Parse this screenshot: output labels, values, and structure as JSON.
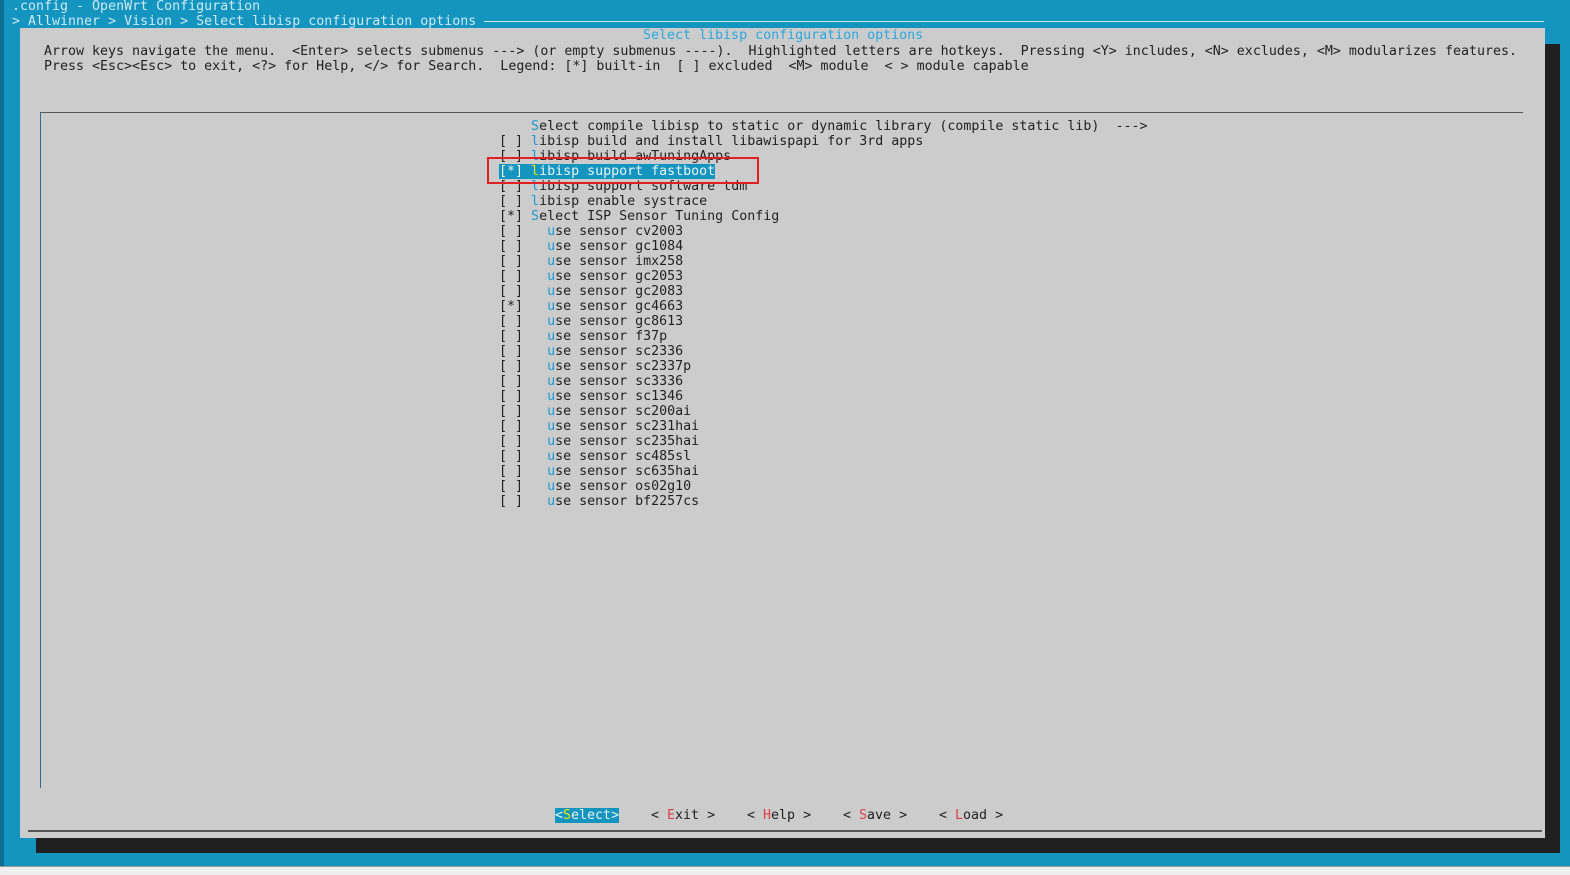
{
  "window": {
    "title": ".config - OpenWrt Configuration",
    "breadcrumb": "> Allwinner > Vision > Select libisp configuration options"
  },
  "dialog": {
    "title": "Select libisp configuration options",
    "help_line1": "Arrow keys navigate the menu.  <Enter> selects submenus ---> (or empty submenus ----).  Highlighted letters are hotkeys.  Pressing <Y> includes, <N> excludes, <M> modularizes features.",
    "help_line2": "Press <Esc><Esc> to exit, <?> for Help, </> for Search.  Legend: [*] built-in  [ ] excluded  <M> module  < > module capable"
  },
  "menu": [
    {
      "box": "   ",
      "indent": "",
      "hk": "S",
      "rest": "elect compile libisp to static or dynamic library (compile static lib)  --->"
    },
    {
      "box": "[ ]",
      "indent": "",
      "hk": "l",
      "rest": "ibisp build and install libawispapi for 3rd apps"
    },
    {
      "box": "[ ]",
      "indent": "",
      "hk": "l",
      "rest": "ibisp build awTuningApps"
    },
    {
      "box": "[*]",
      "indent": "",
      "hk": "l",
      "rest": "ibisp support fastboot",
      "selected": true
    },
    {
      "box": "[ ]",
      "indent": "",
      "hk": "l",
      "rest": "ibisp support software tdm"
    },
    {
      "box": "[ ]",
      "indent": "",
      "hk": "l",
      "rest": "ibisp enable systrace"
    },
    {
      "box": "[*]",
      "indent": "",
      "hk": "S",
      "rest": "elect ISP Sensor Tuning Config"
    },
    {
      "box": "[ ]",
      "indent": "  ",
      "hk": "u",
      "rest": "se sensor cv2003"
    },
    {
      "box": "[ ]",
      "indent": "  ",
      "hk": "u",
      "rest": "se sensor gc1084"
    },
    {
      "box": "[ ]",
      "indent": "  ",
      "hk": "u",
      "rest": "se sensor imx258"
    },
    {
      "box": "[ ]",
      "indent": "  ",
      "hk": "u",
      "rest": "se sensor gc2053"
    },
    {
      "box": "[ ]",
      "indent": "  ",
      "hk": "u",
      "rest": "se sensor gc2083"
    },
    {
      "box": "[*]",
      "indent": "  ",
      "hk": "u",
      "rest": "se sensor gc4663"
    },
    {
      "box": "[ ]",
      "indent": "  ",
      "hk": "u",
      "rest": "se sensor gc8613"
    },
    {
      "box": "[ ]",
      "indent": "  ",
      "hk": "u",
      "rest": "se sensor f37p"
    },
    {
      "box": "[ ]",
      "indent": "  ",
      "hk": "u",
      "rest": "se sensor sc2336"
    },
    {
      "box": "[ ]",
      "indent": "  ",
      "hk": "u",
      "rest": "se sensor sc2337p"
    },
    {
      "box": "[ ]",
      "indent": "  ",
      "hk": "u",
      "rest": "se sensor sc3336"
    },
    {
      "box": "[ ]",
      "indent": "  ",
      "hk": "u",
      "rest": "se sensor sc1346"
    },
    {
      "box": "[ ]",
      "indent": "  ",
      "hk": "u",
      "rest": "se sensor sc200ai"
    },
    {
      "box": "[ ]",
      "indent": "  ",
      "hk": "u",
      "rest": "se sensor sc231hai"
    },
    {
      "box": "[ ]",
      "indent": "  ",
      "hk": "u",
      "rest": "se sensor sc235hai"
    },
    {
      "box": "[ ]",
      "indent": "  ",
      "hk": "u",
      "rest": "se sensor sc485sl"
    },
    {
      "box": "[ ]",
      "indent": "  ",
      "hk": "u",
      "rest": "se sensor sc635hai"
    },
    {
      "box": "[ ]",
      "indent": "  ",
      "hk": "u",
      "rest": "se sensor os02g10"
    },
    {
      "box": "[ ]",
      "indent": "  ",
      "hk": "u",
      "rest": "se sensor bf2257cs"
    }
  ],
  "buttons": [
    {
      "pre": "<",
      "hk": "S",
      "rest": "elect",
      "post": ">"
    },
    {
      "pre": "< ",
      "hk": "E",
      "rest": "xit",
      "post": " >"
    },
    {
      "pre": "< ",
      "hk": "H",
      "rest": "elp",
      "post": " >"
    },
    {
      "pre": "< ",
      "hk": "S",
      "rest": "ave",
      "post": " >"
    },
    {
      "pre": "< ",
      "hk": "L",
      "rest": "oad",
      "post": " >"
    }
  ],
  "colors": {
    "background": "#1395c0",
    "dialog": "#cccccc",
    "hotkey": "#1a9ad6",
    "button_hotkey": "#e0404a",
    "annotation": "#e02020"
  }
}
